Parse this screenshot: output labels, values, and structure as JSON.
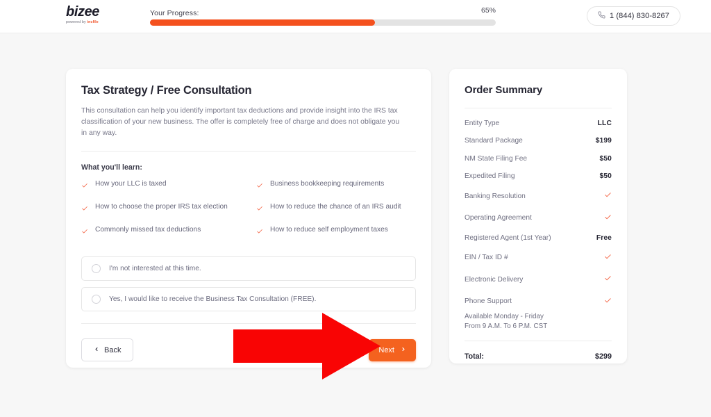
{
  "header": {
    "logo_text": "bizee",
    "logo_tagline_prefix": "powered by ",
    "logo_tagline_brand": "incfile",
    "progress_label": "Your Progress:",
    "progress_percent_text": "65%",
    "progress_percent_value": 65,
    "phone_icon": "phone-icon",
    "phone_number": "1 (844) 830-8267"
  },
  "main": {
    "title": "Tax Strategy / Free Consultation",
    "intro": "This consultation can help you identify important tax deductions and provide insight into the IRS tax classification of your new business. The offer is completely free of charge and does not obligate you in any way.",
    "learn_title": "What you'll learn:",
    "learn_items": [
      "How your LLC is taxed",
      "Business bookkeeping requirements",
      "How to choose the proper IRS tax election",
      "How to reduce the chance of an IRS audit",
      "Commonly missed tax deductions",
      "How to reduce self employment taxes"
    ],
    "options": [
      {
        "label": "I'm not interested at this time.",
        "selected": false
      },
      {
        "label": "Yes, I would like to receive the Business Tax Consultation (FREE).",
        "selected": false
      }
    ],
    "back_label": "Back",
    "next_label": "Next",
    "back_icon": "chevron-left-icon",
    "next_icon": "chevron-right-icon"
  },
  "order_summary": {
    "title": "Order Summary",
    "rows": [
      {
        "label": "Entity Type",
        "value": "LLC",
        "type": "text"
      },
      {
        "label": "Standard Package",
        "value": "$199",
        "type": "text"
      },
      {
        "label": "NM State Filing Fee",
        "value": "$50",
        "type": "text"
      },
      {
        "label": "Expedited Filing",
        "value": "$50",
        "type": "text"
      },
      {
        "label": "Banking Resolution",
        "value": "",
        "type": "check"
      },
      {
        "label": "Operating Agreement",
        "value": "",
        "type": "check"
      },
      {
        "label": "Registered Agent (1st Year)",
        "value": "Free",
        "type": "text"
      },
      {
        "label": "EIN / Tax ID #",
        "value": "",
        "type": "check"
      },
      {
        "label": "Electronic Delivery",
        "value": "",
        "type": "check"
      },
      {
        "label": "Phone Support",
        "value": "",
        "type": "check"
      }
    ],
    "note_line1": "Available Monday - Friday",
    "note_line2": "From 9 A.M. To 6 P.M. CST",
    "total_label": "Total:",
    "total_value": "$299"
  },
  "annotation": {
    "arrow_icon": "red-arrow-pointer",
    "arrow_color": "#f90404",
    "points_to": "next-button"
  },
  "colors": {
    "accent_orange": "#f4511e",
    "next_button": "#f4621f",
    "check_orange": "#f4694a",
    "page_background": "#f7f7f7",
    "card_background": "#ffffff",
    "text_dark": "#262633",
    "text_muted": "#707082"
  }
}
